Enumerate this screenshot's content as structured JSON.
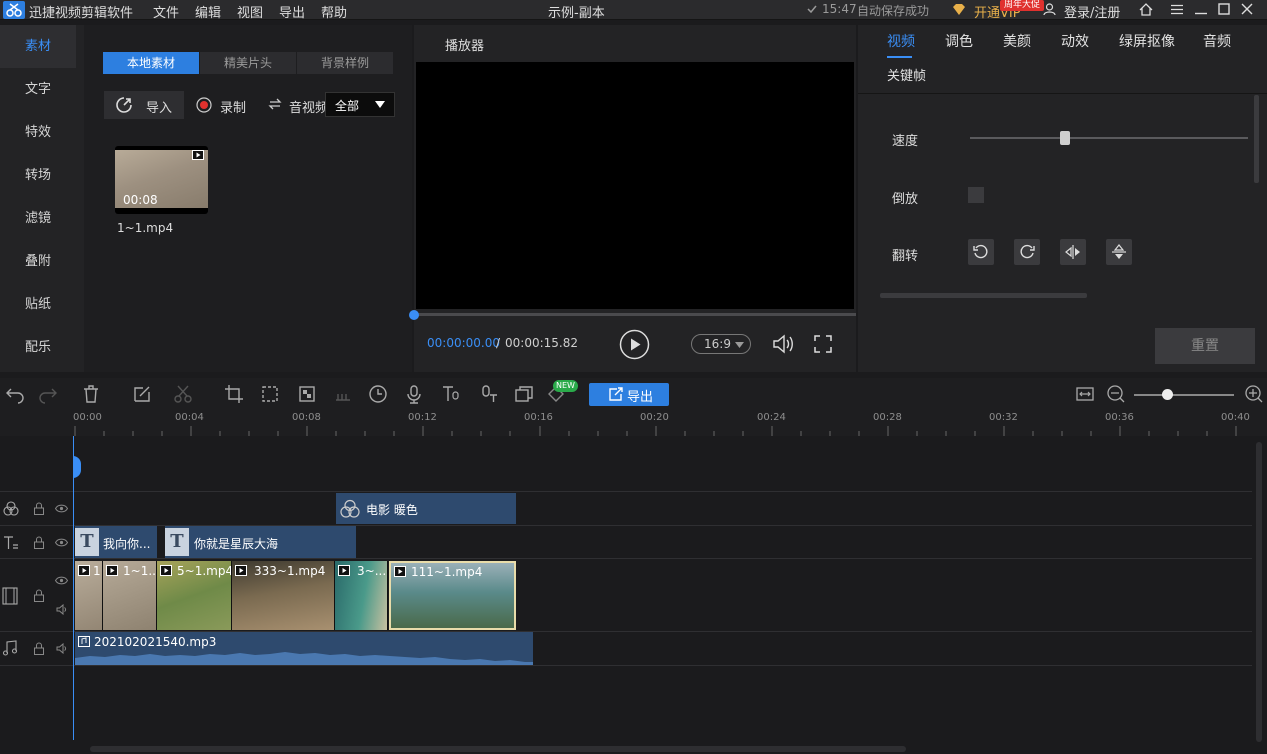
{
  "app": {
    "title": "迅捷视频剪辑软件",
    "window_title": "示例-副本",
    "autosave_time": "15:47",
    "autosave_text": "自动保存成功",
    "vip_label": "开通VIP",
    "vip_badge": "周年大促",
    "login_label": "登录/注册"
  },
  "menu": [
    "文件",
    "编辑",
    "视图",
    "导出",
    "帮助"
  ],
  "leftnav": [
    "素材",
    "文字",
    "特效",
    "转场",
    "滤镜",
    "叠附",
    "贴纸",
    "配乐"
  ],
  "media": {
    "tabs": [
      "本地素材",
      "精美片头",
      "背景样例"
    ],
    "import": "导入",
    "record": "录制",
    "audio_video": "音视频",
    "filter": "全部",
    "clip_duration": "00:08",
    "clip_name": "1~1.mp4"
  },
  "player": {
    "title": "播放器",
    "current": "00:00:00.00",
    "separator": "/",
    "total": "00:00:15.82",
    "ratio": "16:9"
  },
  "props": {
    "tabs": [
      "视频",
      "调色",
      "美颜",
      "动效",
      "绿屏抠像",
      "音频",
      "关键帧"
    ],
    "speed": "速度",
    "speed_level": 0.34,
    "reverse": "倒放",
    "flip": "翻转",
    "reset": "重置"
  },
  "toolbar": {
    "export": "导出",
    "new_badge": "NEW"
  },
  "ruler": [
    "00:00",
    "00:04",
    "00:08",
    "00:12",
    "00:16",
    "00:20",
    "00:24",
    "00:28",
    "00:32",
    "00:36",
    "00:40"
  ],
  "tracks": {
    "filter_clip": "电影 暖色",
    "text_clips": [
      "我向你...",
      "你就是星辰大海"
    ],
    "video_clips": [
      "1",
      "1~1...",
      "5~1.mp4",
      "333~1.mp4",
      "3~...",
      "111~1.mp4"
    ],
    "audio_clip": "202102021540.mp3"
  },
  "colors": {
    "accent": "#2d7fe0",
    "panel": "#232325",
    "track_clip": "#2e4a6e"
  }
}
